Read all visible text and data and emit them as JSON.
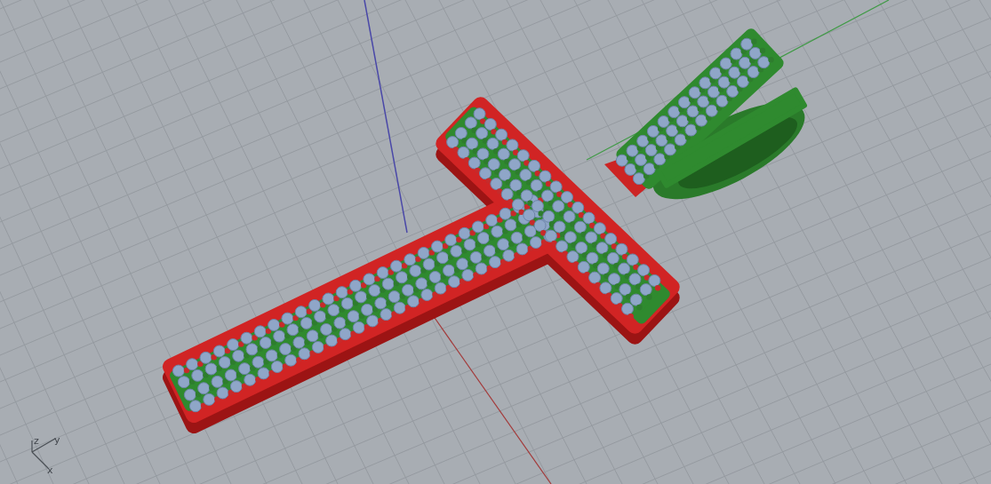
{
  "viewport": {
    "axis_widget": {
      "labels": [
        "z",
        "y",
        "x"
      ]
    }
  }
}
